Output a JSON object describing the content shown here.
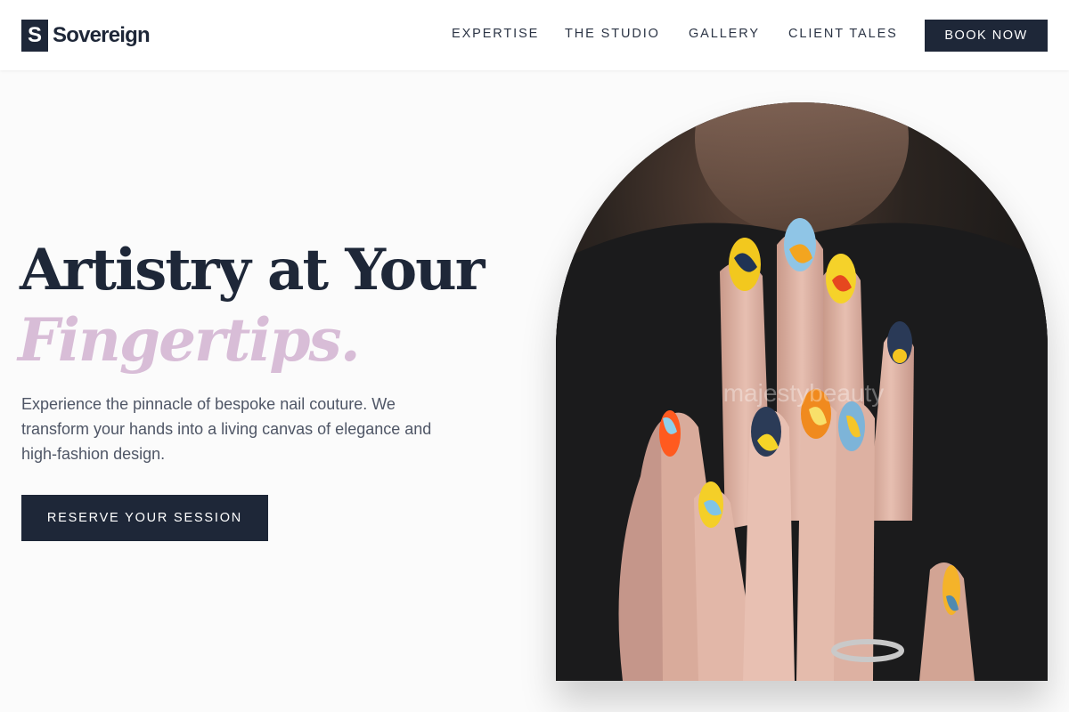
{
  "brand": {
    "mark": "S",
    "name": "Sovereign"
  },
  "nav": {
    "items": [
      {
        "label": "EXPERTISE"
      },
      {
        "label": "THE STUDIO"
      },
      {
        "label": "GALLERY"
      },
      {
        "label": "CLIENT TALES"
      }
    ],
    "cta_label": "BOOK NOW"
  },
  "hero": {
    "title": "Artistry at Your",
    "title_accent": "Fingertips.",
    "description": "Experience the pinnacle of bespoke nail couture. We transform your hands into a living canvas of elegance and high-fashion design.",
    "cta_label": "RESERVE YOUR SESSION",
    "image_watermark": "majestybeauty"
  },
  "colors": {
    "primary": "#1e2738",
    "accent": "#d8bdd7",
    "body_text": "#4f5666",
    "background": "#fbfbfb"
  }
}
